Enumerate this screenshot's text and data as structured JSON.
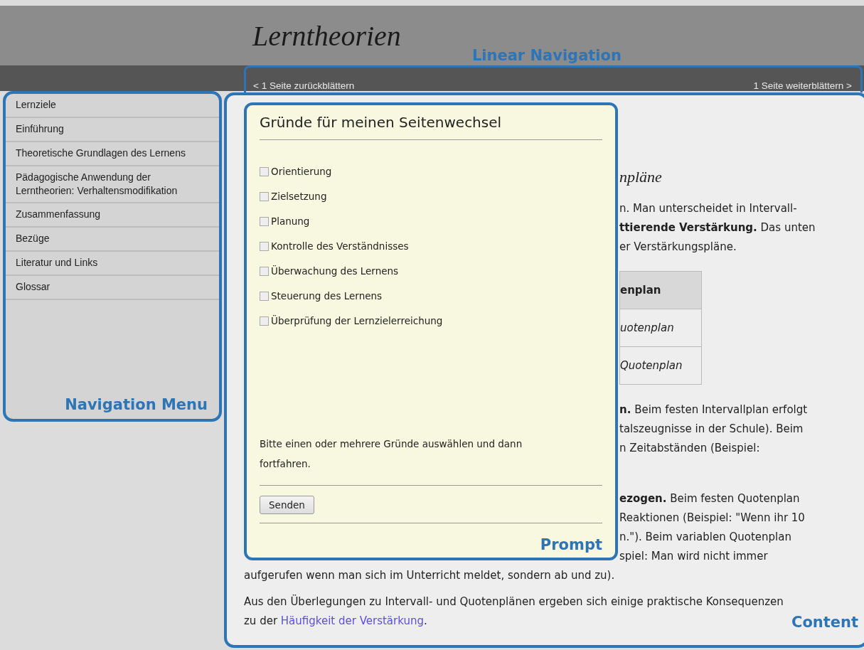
{
  "header": {
    "title": "Lerntheorien",
    "annotation": "Linear Navigation"
  },
  "linear_navigation": {
    "previous": "< 1 Seite zurückblättern",
    "next": "1 Seite weiterblättern >"
  },
  "navigation_menu": {
    "items": [
      {
        "label": "Lernziele"
      },
      {
        "label": "Einführung"
      },
      {
        "label": "Theoretische Grundlagen des Lernens"
      },
      {
        "label": "Pädagogische Anwendung der Lerntheorien: Verhaltensmodifikation"
      },
      {
        "label": "Zusammenfassung"
      },
      {
        "label": "Bezüge"
      },
      {
        "label": "Literatur und Links"
      },
      {
        "label": "Glossar"
      }
    ],
    "annotation": "Navigation Menu"
  },
  "prompt": {
    "title": "Gründe für meinen Seitenwechsel",
    "options": [
      {
        "label": "Orientierung",
        "checked": false
      },
      {
        "label": "Zielsetzung",
        "checked": false
      },
      {
        "label": "Planung",
        "checked": false
      },
      {
        "label": "Kontrolle des Verständnisses",
        "checked": false
      },
      {
        "label": "Überwachung des Lernens",
        "checked": false
      },
      {
        "label": "Steuerung des Lernens",
        "checked": false
      },
      {
        "label": "Überprüfung der Lernzielerreichung",
        "checked": false
      }
    ],
    "hint": "Bitte einen oder mehrere Gründe auswählen und dann fortfahren.",
    "button": "Senden",
    "annotation": "Prompt"
  },
  "content": {
    "heading_fragment": "npläne",
    "paragraph_1_lines": [
      "n. Man unterscheidet in Intervall-",
      "**ttierende Verstärkung.** Das unten",
      "er Verstärkungspläne."
    ],
    "table_fragment": {
      "header": "enplan",
      "rows": [
        "uotenplan",
        "Quotenplan"
      ]
    },
    "paragraph_2_lines": [
      "**n.** Beim festen Intervallplan erfolgt",
      "talszeugnisse in der Schule). Beim",
      "n Zeitabständen (Beispiel:"
    ],
    "paragraph_3_lines": [
      "**ezogen.** Beim festen Quotenplan",
      "Reaktionen (Beispiel: \"Wenn ihr 10",
      "n.\"). Beim variablen Quotenplan",
      "spiel: Man wird nicht immer"
    ],
    "paragraph_3_last": "aufgerufen wenn man sich im Unterricht meldet, sondern ab und zu).",
    "paragraph_4": {
      "before": "Aus den Überlegungen zu Intervall- und Quotenplänen ergeben sich einige praktische Konsequenzen zu der",
      "link": "Häufigkeit der Verstärkung",
      "after": "."
    },
    "annotation": "Content"
  }
}
